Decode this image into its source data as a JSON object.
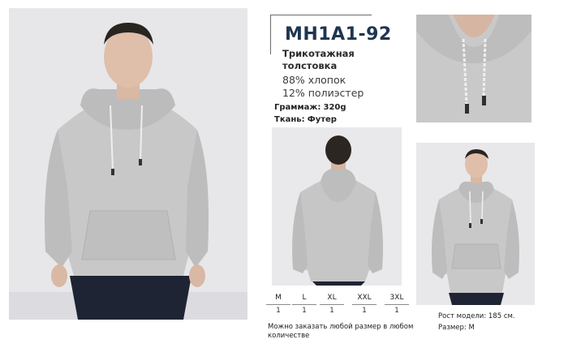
{
  "product": {
    "code": "MH1A1-92",
    "type_line1": "Трикотажная",
    "type_line2": "толстовка",
    "composition_cotton": "88% хлопок",
    "composition_polyester": "12% полиэстер",
    "weight_label": "Граммаж:",
    "weight_value": "320g",
    "fabric_label": "Ткань:",
    "fabric_value": "Футер"
  },
  "sizes": [
    {
      "label": "M",
      "qty": "1"
    },
    {
      "label": "L",
      "qty": "1"
    },
    {
      "label": "XL",
      "qty": "1"
    },
    {
      "label": "XXL",
      "qty": "1"
    },
    {
      "label": "3XL",
      "qty": "1"
    }
  ],
  "order_note": "Можно заказать любой размер в любом количестве",
  "model": {
    "height": "Рост модели: 185 см.",
    "size": "Размер: M"
  },
  "colors": {
    "brand": "#1f3550",
    "hoodie": "#c9c9c9",
    "background": "#e6e6e8"
  }
}
